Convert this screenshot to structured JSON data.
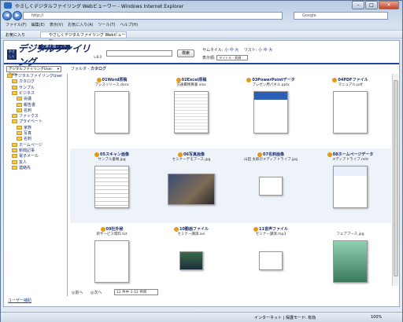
{
  "browser": {
    "title": "やさしくデジタルファイリング Webビューワー - Windows Internet Explorer",
    "url": "http://",
    "search_placeholder": "Google",
    "menu": [
      "ファイル(F)",
      "編集(E)",
      "表示(V)",
      "お気に入り(A)",
      "ツール(T)",
      "ヘルプ(H)"
    ],
    "favorites_label": "お気に入り",
    "tab_label": "やさしくデジタルファイリング Webビューワー",
    "status_zone": "インターネット | 保護モード: 有効",
    "zoom": "100%"
  },
  "app": {
    "logo_tag": "文書管理ソフト",
    "logo_name": "デジタルファイリング",
    "logo_ver": "v.8.0",
    "search_button": "検索",
    "thumb_size_label": "サムネイル:",
    "list_label": "リスト:",
    "sizes": [
      "小",
      "中",
      "大"
    ],
    "display_order_label": "表示順:",
    "display_order_value": "タイトル - 昇順",
    "left_select": "デジタルファイリングUser Data",
    "folder_prefix": "フォルダ - ",
    "folder_name": "カタログ",
    "tree": [
      "デジタルファイリングUser",
      "カタログ",
      "サンプル",
      "ビジネス",
      "会議",
      "報告書",
      "名刺",
      "ファックス",
      "プライベート",
      "家族",
      "写真",
      "名刺",
      "ホームページ",
      "新聞記事",
      "電子メール",
      "友人",
      "連絡先"
    ],
    "items": [
      {
        "title": "01Word原稿",
        "sub": "プレスリリース.docx"
      },
      {
        "title": "02Excel原稿",
        "sub": "交通費精算書.xlsx"
      },
      {
        "title": "03PowerPointデータ",
        "sub": "プレゼン用パネル.pptx"
      },
      {
        "title": "04PDFファイル",
        "sub": "マニュアル.pdf"
      },
      {
        "title": "05スキャン画像",
        "sub": "サンプル書類.jpg"
      },
      {
        "title": "06写真画像",
        "sub": "セミナーデモブース.jpg"
      },
      {
        "title": "07名刺画像",
        "sub": "山田 太郎＠メディアドライブ.jpg"
      },
      {
        "title": "08ホームページデータ",
        "sub": "メディアドライブ.mht"
      },
      {
        "title": "09社外秘",
        "sub": "新サービス資料.txt"
      },
      {
        "title": "10動画ファイル",
        "sub": "セミナー講演.avi"
      },
      {
        "title": "11音声ファイル",
        "sub": "セミナー講演.mp3"
      },
      {
        "title": "",
        "sub": "フェアブース.jpg"
      }
    ],
    "pager_prev": "前へ",
    "pager_next": "次へ",
    "pager_value": "12 件中 1-12 件目",
    "status_link": "ユーザー補助"
  }
}
